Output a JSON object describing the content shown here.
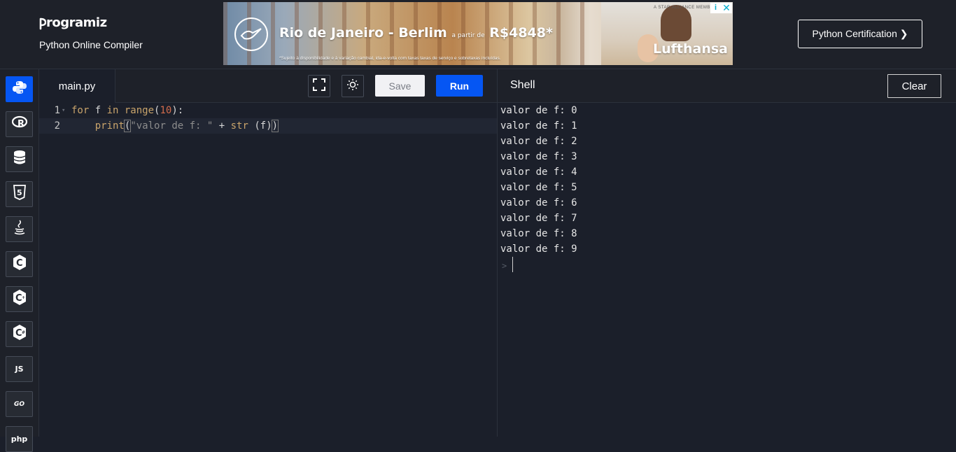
{
  "header": {
    "logo_text": "rogramiz",
    "subtitle": "Python Online Compiler",
    "cert_button": "Python Certification ❯"
  },
  "ad": {
    "headline": "Rio de Janeiro - Berlim",
    "headline_small": "a partir de",
    "price": "R$4848*",
    "fine_print": "*Sujeito à disponibilidade e à variação cambial, ida-e-volta com taxas taxas de serviço e sobretaxas incluídas.",
    "brand": "Lufthansa",
    "member": "A STAR ALLIANCE MEMBER",
    "info": "i",
    "close": "✕"
  },
  "sidebar": {
    "items": [
      {
        "name": "python",
        "icon": "python-icon",
        "active": true
      },
      {
        "name": "r",
        "icon": "r-icon",
        "active": false
      },
      {
        "name": "sql",
        "icon": "database-icon",
        "active": false
      },
      {
        "name": "html",
        "icon": "html5-icon",
        "active": false
      },
      {
        "name": "java",
        "icon": "java-icon",
        "active": false
      },
      {
        "name": "c",
        "icon": "c-icon",
        "active": false
      },
      {
        "name": "cpp",
        "icon": "cpp-icon",
        "active": false
      },
      {
        "name": "csharp",
        "icon": "csharp-icon",
        "active": false
      },
      {
        "name": "js",
        "label": "JS",
        "icon": "js-icon",
        "active": false
      },
      {
        "name": "go",
        "label": "GO",
        "icon": "go-icon",
        "active": false
      },
      {
        "name": "php",
        "label": "php",
        "icon": "php-icon",
        "active": false
      }
    ]
  },
  "editor": {
    "file_tab": "main.py",
    "save_label": "Save",
    "run_label": "Run",
    "lines": [
      {
        "number": "1"
      },
      {
        "number": "2"
      }
    ],
    "code": {
      "l1_for": "for",
      "l1_f": " f ",
      "l1_in": "in",
      "l1_range": " range",
      "l1_open": "(",
      "l1_num": "10",
      "l1_close": "):",
      "l2_indent": "    ",
      "l2_print": "print",
      "l2_open": "(",
      "l2_str": "\"valor de f: \"",
      "l2_plus": " + ",
      "l2_strfn": "str",
      "l2_arg": " (f)",
      "l2_close": ")"
    }
  },
  "shell": {
    "title": "Shell",
    "clear_label": "Clear",
    "output": [
      "valor de f: 0",
      "valor de f: 1",
      "valor de f: 2",
      "valor de f: 3",
      "valor de f: 4",
      "valor de f: 5",
      "valor de f: 6",
      "valor de f: 7",
      "valor de f: 8",
      "valor de f: 9"
    ],
    "prompt": ">"
  },
  "colors": {
    "accent": "#0556f3",
    "background": "#1b1f2a",
    "panel": "#1e2129"
  }
}
